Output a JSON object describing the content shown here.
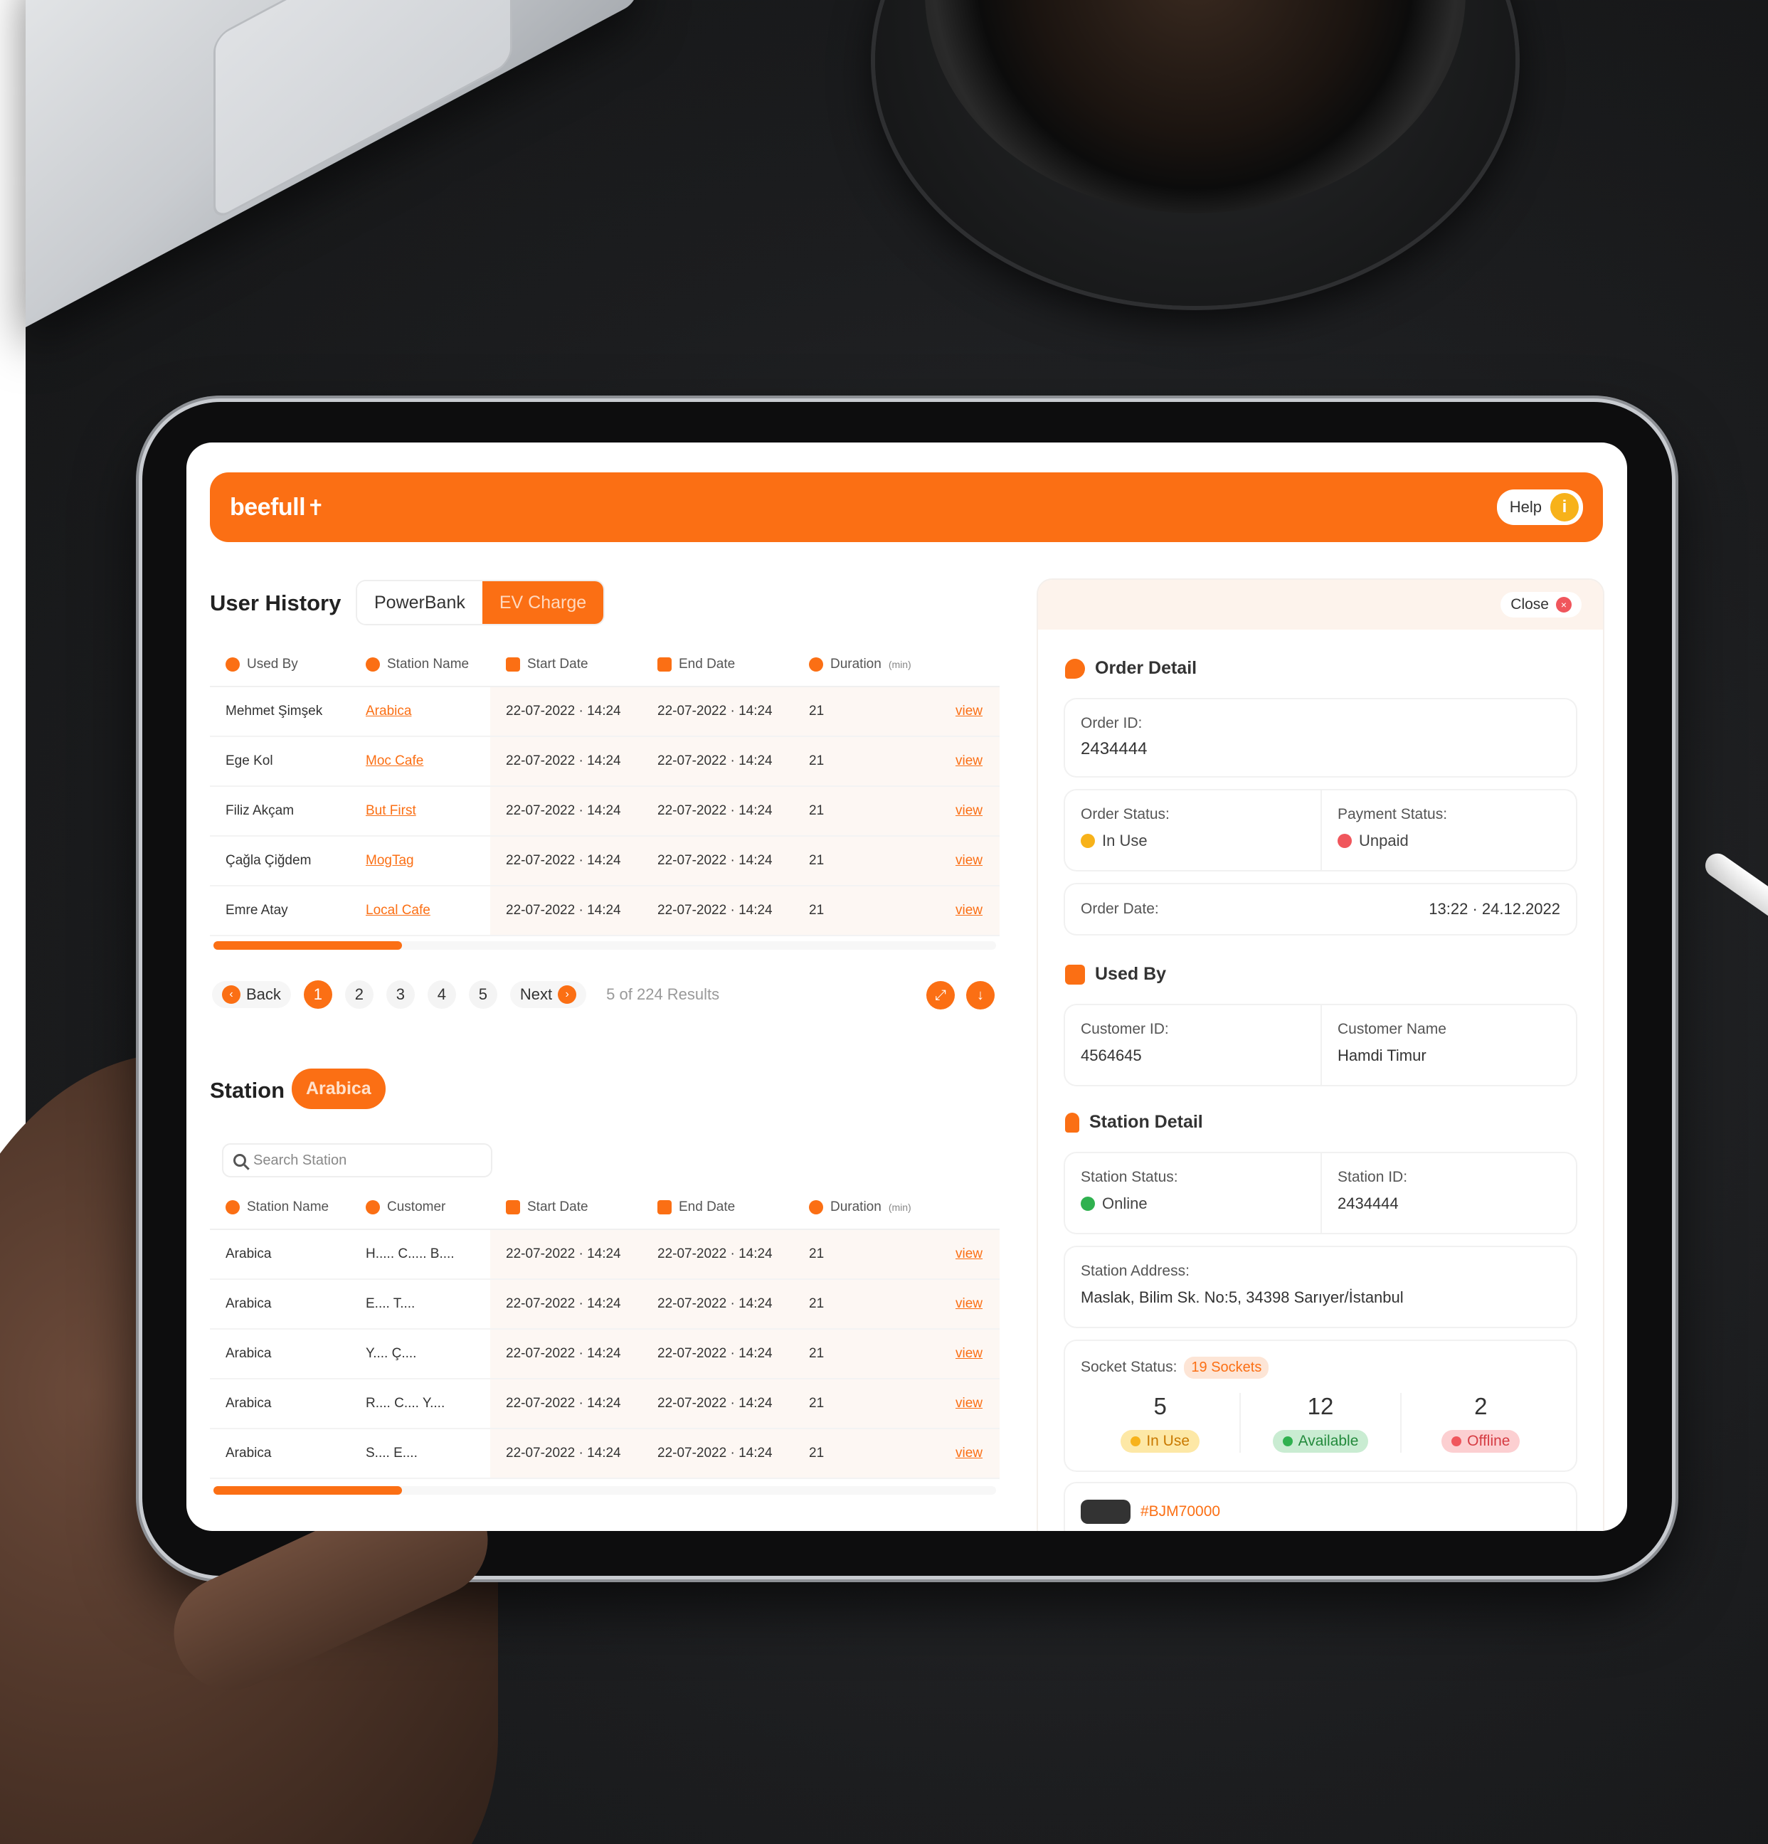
{
  "brand": {
    "logo_text": "beefull",
    "accent": "#fb6f14"
  },
  "header": {
    "help_label": "Help",
    "help_icon": "i"
  },
  "user_history": {
    "title": "User History",
    "tabs": [
      {
        "label": "PowerBank"
      },
      {
        "label": "EV Charge"
      }
    ],
    "columns": [
      "Used By",
      "Station Name",
      "Start Date",
      "End Date",
      "Duration",
      "(min)"
    ],
    "rows": [
      {
        "used_by": "Mehmet Şimşek",
        "station": "Arabica",
        "start": "22-07-2022 · 14:24",
        "end": "22-07-2022 · 14:24",
        "duration": "21",
        "action": "view"
      },
      {
        "used_by": "Ege Kol",
        "station": "Moc Cafe",
        "start": "22-07-2022 · 14:24",
        "end": "22-07-2022 · 14:24",
        "duration": "21",
        "action": "view"
      },
      {
        "used_by": "Filiz Akçam",
        "station": "But First",
        "start": "22-07-2022 · 14:24",
        "end": "22-07-2022 · 14:24",
        "duration": "21",
        "action": "view"
      },
      {
        "used_by": "Çağla Çiğdem",
        "station": "MogTag",
        "start": "22-07-2022 · 14:24",
        "end": "22-07-2022 · 14:24",
        "duration": "21",
        "action": "view"
      },
      {
        "used_by": "Emre Atay",
        "station": "Local Cafe",
        "start": "22-07-2022 · 14:24",
        "end": "22-07-2022 · 14:24",
        "duration": "21",
        "action": "view"
      }
    ],
    "pager": {
      "back": "Back",
      "pages": [
        "1",
        "2",
        "3",
        "4",
        "5"
      ],
      "next": "Next",
      "info": "5 of 224 Results"
    }
  },
  "station": {
    "title": "Station",
    "selected": "Arabica",
    "search_placeholder": "Search Station",
    "columns": [
      "Station Name",
      "Customer",
      "Start Date",
      "End Date",
      "Duration",
      "(min)"
    ],
    "rows": [
      {
        "station": "Arabica",
        "customer": "H..... C..... B....",
        "start": "22-07-2022 · 14:24",
        "end": "22-07-2022 · 14:24",
        "duration": "21",
        "action": "view"
      },
      {
        "station": "Arabica",
        "customer": "E.... T....",
        "start": "22-07-2022 · 14:24",
        "end": "22-07-2022 · 14:24",
        "duration": "21",
        "action": "view"
      },
      {
        "station": "Arabica",
        "customer": "Y.... Ç....",
        "start": "22-07-2022 · 14:24",
        "end": "22-07-2022 · 14:24",
        "duration": "21",
        "action": "view"
      },
      {
        "station": "Arabica",
        "customer": "R.... C.... Y....",
        "start": "22-07-2022 · 14:24",
        "end": "22-07-2022 · 14:24",
        "duration": "21",
        "action": "view"
      },
      {
        "station": "Arabica",
        "customer": "S.... E....",
        "start": "22-07-2022 · 14:24",
        "end": "22-07-2022 · 14:24",
        "duration": "21",
        "action": "view"
      }
    ]
  },
  "detail": {
    "close_label": "Close",
    "order": {
      "title": "Order Detail",
      "order_id_label": "Order ID:",
      "order_id": "2434444",
      "order_status_label": "Order Status:",
      "order_status": "In Use",
      "payment_status_label": "Payment Status:",
      "payment_status": "Unpaid",
      "order_date_label": "Order Date:",
      "order_date": "13:22 · 24.12.2022"
    },
    "used_by": {
      "title": "Used By",
      "customer_id_label": "Customer ID:",
      "customer_id": "4564645",
      "customer_name_label": "Customer Name",
      "customer_name": "Hamdi Timur"
    },
    "station": {
      "title": "Station Detail",
      "status_label": "Station Status:",
      "status": "Online",
      "id_label": "Station ID:",
      "id": "2434444",
      "address_label": "Station Address:",
      "address": "Maslak, Bilim Sk. No:5, 34398 Sarıyer/İstanbul",
      "socket_label": "Socket Status:",
      "socket_total": "19 Sockets",
      "sockets": [
        {
          "count": "5",
          "label": "In Use",
          "color": "#f7b21a"
        },
        {
          "count": "12",
          "label": "Available",
          "color": "#2fb14f"
        },
        {
          "count": "2",
          "label": "Offline",
          "color": "#f0565c"
        }
      ],
      "device_code": "#BJM70000"
    }
  }
}
